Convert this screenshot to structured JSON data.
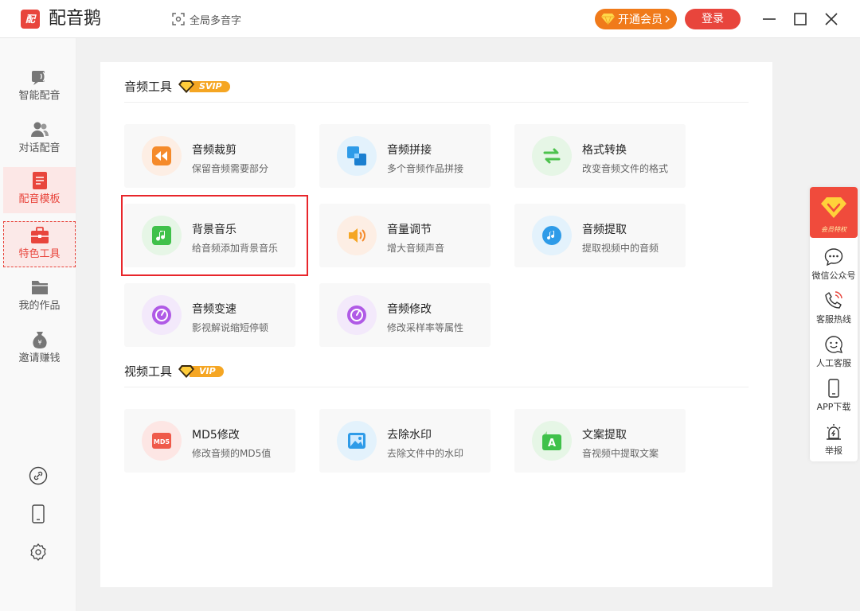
{
  "app": {
    "logo": "配",
    "name": "配音鹅"
  },
  "header": {
    "global_poly": "全局多音字",
    "vip_button": "开通会员",
    "login_button": "登录"
  },
  "sidebar": {
    "items": [
      {
        "label": "智能配音",
        "icon": "voice-icon"
      },
      {
        "label": "对话配音",
        "icon": "users-icon"
      },
      {
        "label": "配音模板",
        "icon": "template-icon"
      },
      {
        "label": "特色工具",
        "icon": "toolbox-icon"
      },
      {
        "label": "我的作品",
        "icon": "folder-icon"
      },
      {
        "label": "邀请赚钱",
        "icon": "money-bag-icon"
      }
    ]
  },
  "audio_tools": {
    "title": "音频工具",
    "badge": "SVIP",
    "cards": [
      {
        "title": "音频裁剪",
        "desc": "保留音频需要部分"
      },
      {
        "title": "音频拼接",
        "desc": "多个音频作品拼接"
      },
      {
        "title": "格式转换",
        "desc": "改变音频文件的格式"
      },
      {
        "title": "背景音乐",
        "desc": "给音频添加背景音乐"
      },
      {
        "title": "音量调节",
        "desc": "增大音频声音"
      },
      {
        "title": "音频提取",
        "desc": "提取视频中的音频"
      },
      {
        "title": "音频变速",
        "desc": "影视解说缩短停顿"
      },
      {
        "title": "音频修改",
        "desc": "修改采样率等属性"
      }
    ]
  },
  "video_tools": {
    "title": "视频工具",
    "badge": "VIP",
    "cards": [
      {
        "title": "MD5修改",
        "desc": "修改音频的MD5值",
        "icon_text": "MD5"
      },
      {
        "title": "去除水印",
        "desc": "去除文件中的水印"
      },
      {
        "title": "文案提取",
        "desc": "音视频中提取文案",
        "icon_text": "A"
      }
    ]
  },
  "rightbar": {
    "member": "会员特权",
    "items": [
      {
        "label": "微信公众号"
      },
      {
        "label": "客服热线"
      },
      {
        "label": "人工客服"
      },
      {
        "label": "APP下载"
      },
      {
        "label": "举报"
      }
    ]
  },
  "colors": {
    "brand_red": "#e8453c",
    "vip_orange": "#f07a1a",
    "badge_gold": "#f5a623",
    "highlight_red": "#e8262b"
  }
}
